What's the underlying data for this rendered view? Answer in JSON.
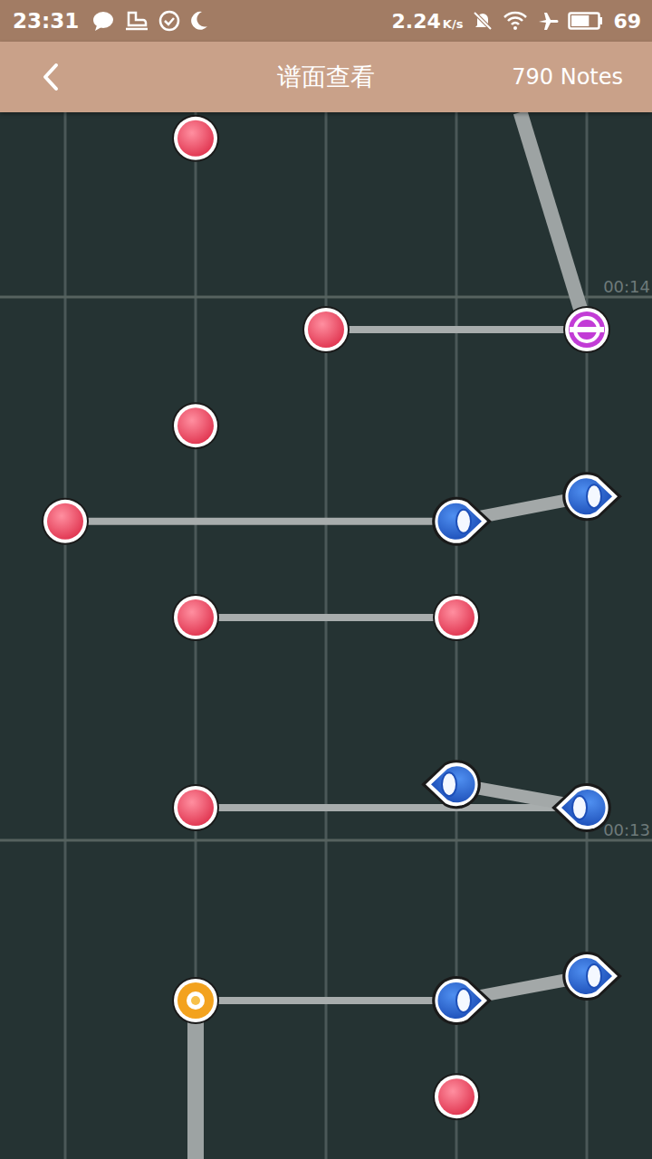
{
  "status_bar": {
    "time": "23:31",
    "speed": "2.24",
    "speed_unit": "K/s",
    "battery": {
      "reading": "69",
      "level": 0.69
    }
  },
  "header": {
    "title": "谱面查看",
    "count": "790 Notes"
  },
  "time_markers": [
    {
      "label": "00:14",
      "time": 14
    },
    {
      "label": "00:13",
      "time": 13
    }
  ],
  "notes": [
    {
      "kind": "tap",
      "lane": 1,
      "time": 14.292
    },
    {
      "kind": "tap",
      "lane": 2,
      "time": 13.94
    },
    {
      "kind": "slide",
      "lane": 4,
      "time": 13.94,
      "path_to": {
        "lane": 3.49,
        "time": 14.34
      }
    },
    {
      "kind": "tap",
      "lane": 1,
      "time": 13.763
    },
    {
      "kind": "tap",
      "lane": 0,
      "time": 13.587
    },
    {
      "kind": "flick",
      "lane": 3,
      "time": 13.587,
      "direction": "right"
    },
    {
      "kind": "flick",
      "lane": 4,
      "time": 13.633,
      "direction": "right"
    },
    {
      "kind": "tap",
      "lane": 1,
      "time": 13.41
    },
    {
      "kind": "tap",
      "lane": 3,
      "time": 13.41
    },
    {
      "kind": "tap",
      "lane": 1,
      "time": 13.06
    },
    {
      "kind": "flick",
      "lane": 3,
      "time": 13.103,
      "direction": "left"
    },
    {
      "kind": "flick",
      "lane": 4,
      "time": 13.06,
      "direction": "left"
    },
    {
      "kind": "hold",
      "lane": 1,
      "time": 12.705,
      "length": 0.4
    },
    {
      "kind": "flick",
      "lane": 3,
      "time": 12.705,
      "direction": "right"
    },
    {
      "kind": "flick",
      "lane": 4,
      "time": 12.75,
      "direction": "right"
    },
    {
      "kind": "tap",
      "lane": 3,
      "time": 12.528
    }
  ],
  "links": [
    {
      "kind": "sync",
      "from": 1,
      "to": 2
    },
    {
      "kind": "sync",
      "from": 4,
      "to": 5
    },
    {
      "kind": "sync",
      "from": 7,
      "to": 8
    },
    {
      "kind": "sync",
      "from": 9,
      "to": 11
    },
    {
      "kind": "sync",
      "from": 12,
      "to": 13
    },
    {
      "kind": "chain",
      "from": 5,
      "to": 6
    },
    {
      "kind": "chain",
      "from": 10,
      "to": 11
    },
    {
      "kind": "chain",
      "from": 13,
      "to": 14
    }
  ]
}
